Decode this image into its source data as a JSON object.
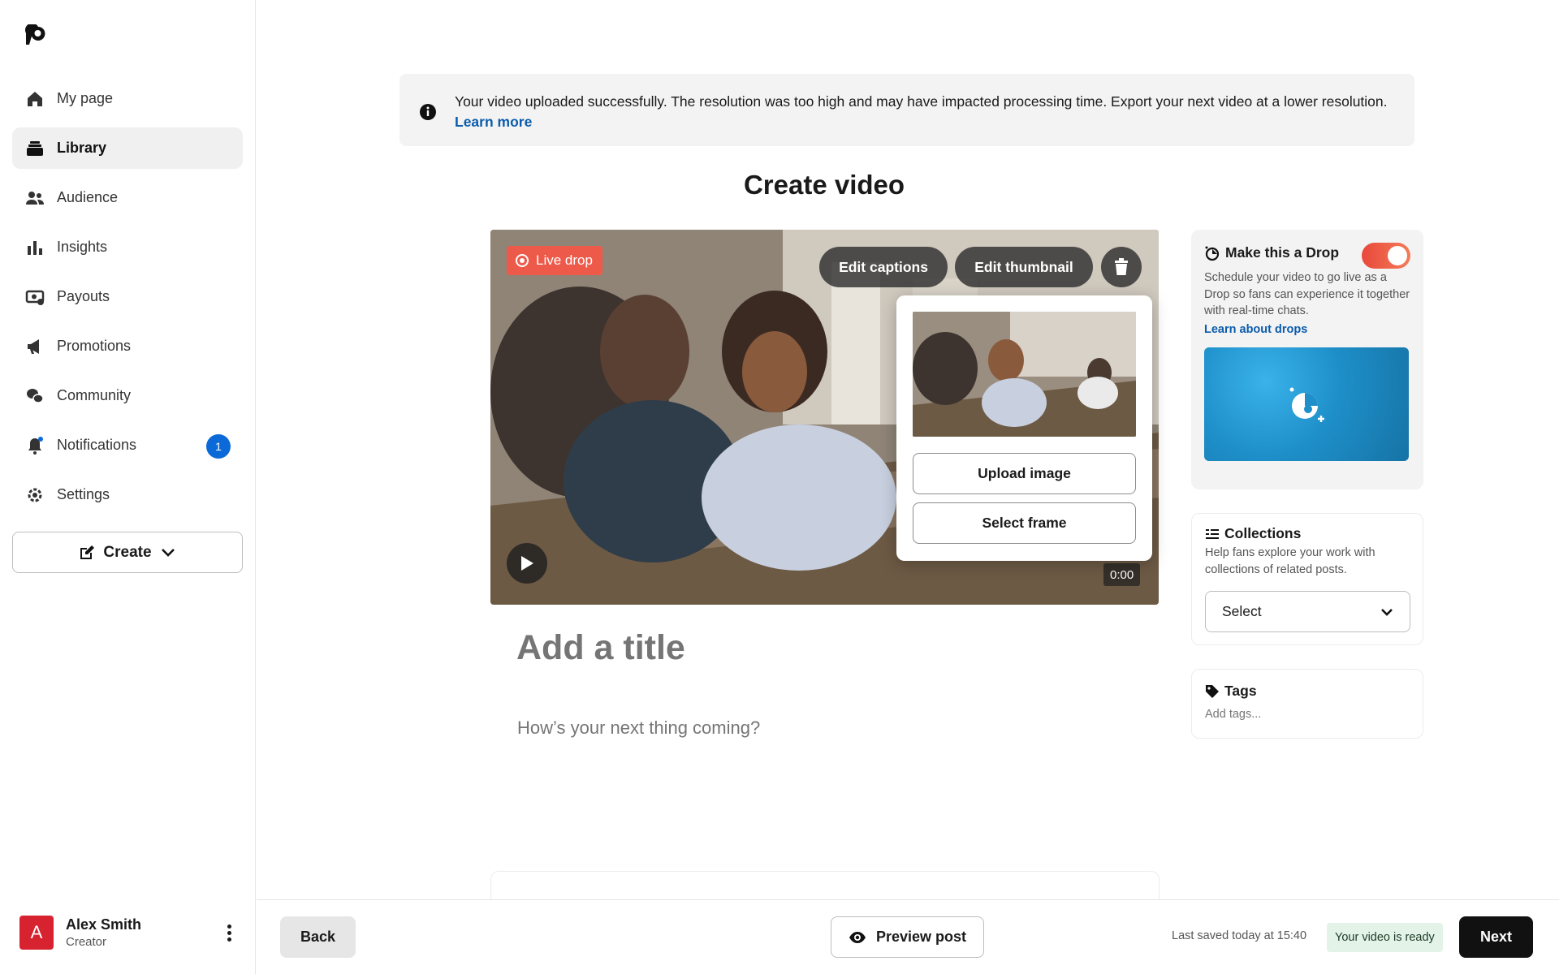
{
  "sidebar": {
    "items": [
      {
        "label": "My page",
        "icon": "home-icon"
      },
      {
        "label": "Library",
        "icon": "library-icon",
        "active": true
      },
      {
        "label": "Audience",
        "icon": "audience-icon"
      },
      {
        "label": "Insights",
        "icon": "insights-icon"
      },
      {
        "label": "Payouts",
        "icon": "payouts-icon"
      },
      {
        "label": "Promotions",
        "icon": "megaphone-icon"
      },
      {
        "label": "Community",
        "icon": "chat-icon"
      },
      {
        "label": "Notifications",
        "icon": "bell-icon",
        "badge": "1"
      },
      {
        "label": "Settings",
        "icon": "gear-icon"
      }
    ],
    "create_label": "Create",
    "user": {
      "initial": "A",
      "name": "Alex Smith",
      "role": "Creator"
    }
  },
  "banner": {
    "text": "Your video uploaded successfully. The resolution was too high and may have impacted processing time. Export your next video at a lower resolution.",
    "link": "Learn more"
  },
  "page_title": "Create video",
  "video": {
    "live_label": "Live drop",
    "edit_captions": "Edit captions",
    "edit_thumbnail": "Edit thumbnail",
    "time": "0:00"
  },
  "thumbnail_popover": {
    "upload_label": "Upload image",
    "select_frame_label": "Select frame"
  },
  "post": {
    "title_placeholder": "Add a title",
    "body_placeholder": "How’s your next thing coming?"
  },
  "drop_card": {
    "title": "Make this a Drop",
    "enabled": true,
    "description": "Schedule your video to go live as a Drop so fans can experience it together with real-time chats.",
    "link": "Learn about drops"
  },
  "collections_card": {
    "title": "Collections",
    "description": "Help fans explore your work with collections of related posts.",
    "select_value": "Select"
  },
  "tags_card": {
    "title": "Tags",
    "placeholder": "Add tags..."
  },
  "footer": {
    "back_label": "Back",
    "preview_label": "Preview post",
    "saved_text": "Last saved today at 15:40",
    "ready_text": "Your video is ready",
    "next_label": "Next"
  },
  "colors": {
    "accent": "#0b6ad7",
    "live": "#ee5a4a",
    "ready_bg": "#e3f3e8"
  }
}
